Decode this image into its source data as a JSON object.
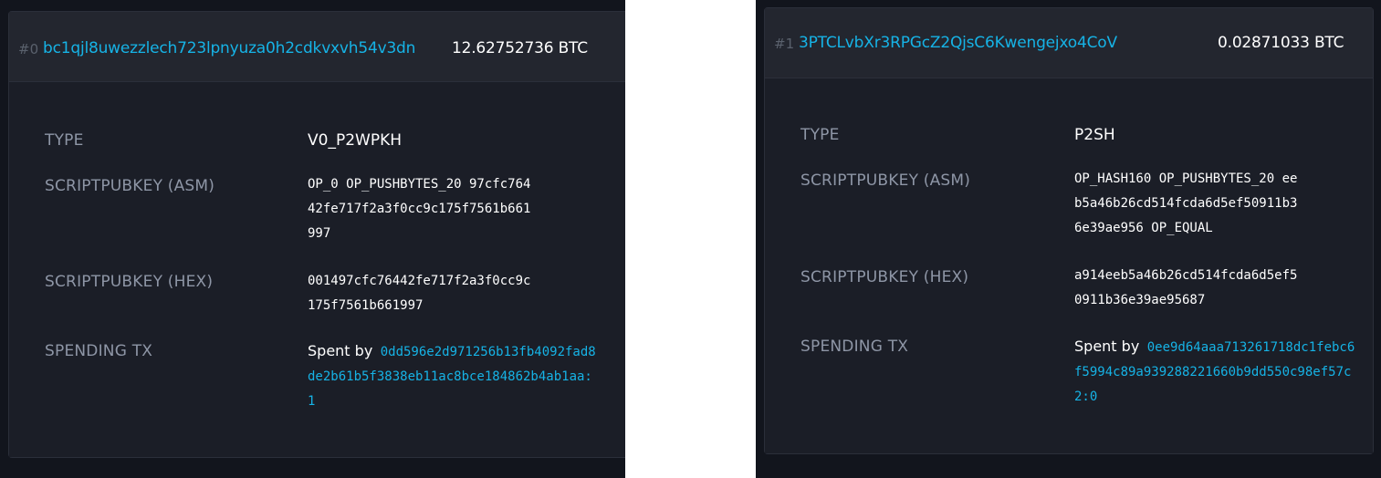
{
  "outputs": [
    {
      "index": "#0",
      "address": "bc1qjl8uwezzlech723lpnyuza0h2cdkvxvh54v3dn",
      "amount": "12.62752736 BTC",
      "labels": {
        "type": "TYPE",
        "asm": "SCRIPTPUBKEY (ASM)",
        "hex": "SCRIPTPUBKEY (HEX)",
        "spending": "SPENDING TX"
      },
      "type": "V0_P2WPKH",
      "asm": "OP_0 OP_PUSHBYTES_20 97cfc764\n42fe717f2a3f0cc9c175f7561b661\n997",
      "hex": "001497cfc76442fe717f2a3f0cc9c\n175f7561b661997",
      "spent_prefix": "Spent by",
      "spent_tx": "0dd596e2d971256b13fb4092fad8de2b61b5f3838eb11ac8bce184862b4ab1aa:1"
    },
    {
      "index": "#1",
      "address": "3PTCLvbXr3RPGcZ2QjsC6Kwengejxo4CoV",
      "amount": "0.02871033 BTC",
      "labels": {
        "type": "TYPE",
        "asm": "SCRIPTPUBKEY (ASM)",
        "hex": "SCRIPTPUBKEY (HEX)",
        "spending": "SPENDING TX"
      },
      "type": "P2SH",
      "asm": "OP_HASH160 OP_PUSHBYTES_20 ee\nb5a46b26cd514fcda6d5ef50911b3\n6e39ae956 OP_EQUAL",
      "hex": "a914eeb5a46b26cd514fcda6d5ef5\n0911b36e39ae95687",
      "spent_prefix": "Spent by",
      "spent_tx": "0ee9d64aaa713261718dc1febc6f5994c89a939288221660b9dd550c98ef57c2:0"
    }
  ],
  "colors": {
    "background": "#12151d",
    "card": "#1d2029",
    "header": "#23262f",
    "link": "#16b3e6",
    "label": "#8e96a6",
    "index": "#5a616d",
    "value": "#ffffff"
  }
}
